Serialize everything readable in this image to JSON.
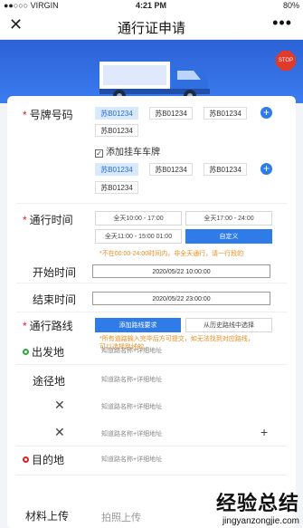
{
  "status": {
    "carrier": "●●○○○ VIRGIN",
    "time": "4:21 PM",
    "battery": "80%"
  },
  "nav": {
    "close": "✕",
    "title": "通行证申请",
    "more": "•••"
  },
  "form": {
    "plate_label": "号牌号码",
    "plates_row1": [
      "苏B01234",
      "苏B01234",
      "苏B01234"
    ],
    "plates_row1b": [
      "苏B01234"
    ],
    "trailer_label": "添加挂车车牌",
    "plates_row2": [
      "苏B01234",
      "苏B01234",
      "苏B01234"
    ],
    "plates_row2b": [
      "苏B01234"
    ],
    "time_label": "通行时间",
    "time_slots": [
      "全天10:00 - 17:00",
      "全天17:00 - 24:00",
      "全天11:00 - 15:00 01:00",
      "自定义"
    ],
    "time_warning": "*不在00:00-24:00时间内，非全天通行，请一行段的",
    "start_label": "开始时间",
    "start_value": "2020/05/22 10:00:00",
    "end_label": "结束时间",
    "end_value": "2020/05/22 23:00:00",
    "route_label": "通行路线",
    "route_buttons": [
      "添加路线要求",
      "从历史路线中选择"
    ],
    "route_warning": "*所有道路输入完毕后方可提交，如无法找到对应路线，可以选择路线的...",
    "origin_label": "出发地",
    "origin_hint": "知道路名称+详细地址",
    "waypoint_label": "途径地",
    "waypoint_hints": [
      "知道路名称+详细地址",
      "知道路名称+详细地址",
      "知道路名称+详细地址"
    ],
    "dest_label": "目的地",
    "dest_hint": "知道路名称+详细地址",
    "upload_label": "材料上传",
    "upload_hint": "拍照上传"
  },
  "watermark": {
    "cn": "经验总结",
    "url": "jingyanzongjie.com"
  },
  "colors": {
    "primary": "#2f7be8",
    "warning": "#f08a1c",
    "required": "#e02020"
  }
}
